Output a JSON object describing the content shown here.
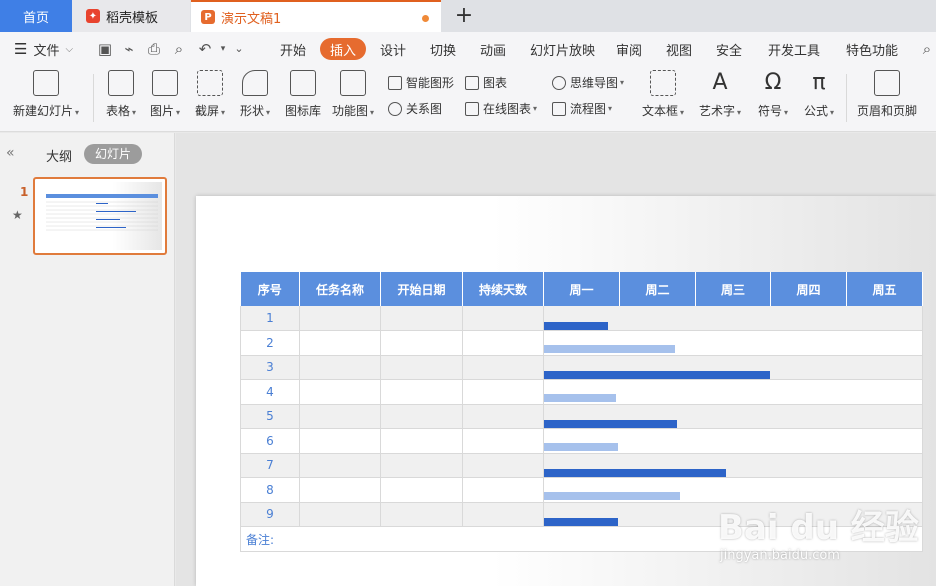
{
  "tabs": {
    "home": "首页",
    "template": "稻壳模板",
    "document": "演示文稿1"
  },
  "menu": {
    "file": "文件",
    "items": [
      "开始",
      "插入",
      "设计",
      "切换",
      "动画",
      "幻灯片放映",
      "审阅",
      "视图",
      "安全",
      "开发工具",
      "特色功能"
    ],
    "active": "插入"
  },
  "ribbon": {
    "new_slide": "新建幻灯片",
    "table": "表格",
    "image": "图片",
    "screenshot": "截屏",
    "shape": "形状",
    "icon_library": "图标库",
    "function_chart": "功能图",
    "smart_shape": "智能图形",
    "chart": "图表",
    "relation_chart": "关系图",
    "online_chart": "在线图表",
    "mind_map": "思维导图",
    "flowchart": "流程图",
    "textbox": "文本框",
    "art_text": "艺术字",
    "symbol": "符号",
    "formula": "公式",
    "header_footer": "页眉和页脚"
  },
  "left_panel": {
    "outline": "大纲",
    "slides": "幻灯片",
    "slide_number": "1"
  },
  "gantt": {
    "headers": [
      "序号",
      "任务名称",
      "开始日期",
      "持续天数",
      "周一",
      "周二",
      "周三",
      "周四",
      "周五"
    ],
    "rows": [
      {
        "num": "1",
        "bar": 0.17,
        "style": "dark"
      },
      {
        "num": "2",
        "bar": 0.345,
        "style": "light"
      },
      {
        "num": "3",
        "bar": 0.595,
        "style": "dark"
      },
      {
        "num": "4",
        "bar": 0.19,
        "style": "light"
      },
      {
        "num": "5",
        "bar": 0.35,
        "style": "dark"
      },
      {
        "num": "6",
        "bar": 0.195,
        "style": "light"
      },
      {
        "num": "7",
        "bar": 0.48,
        "style": "dark"
      },
      {
        "num": "8",
        "bar": 0.36,
        "style": "light"
      },
      {
        "num": "9",
        "bar": 0.195,
        "style": "dark"
      }
    ],
    "note": "备注:"
  },
  "watermark": {
    "text": "Bai du 经验",
    "url": "jingyan.baidu.com"
  },
  "colors": {
    "accent": "#e0601f",
    "header_blue": "#5b8fde",
    "bar_dark": "#2d64c8",
    "bar_light": "#a6c1ec"
  }
}
